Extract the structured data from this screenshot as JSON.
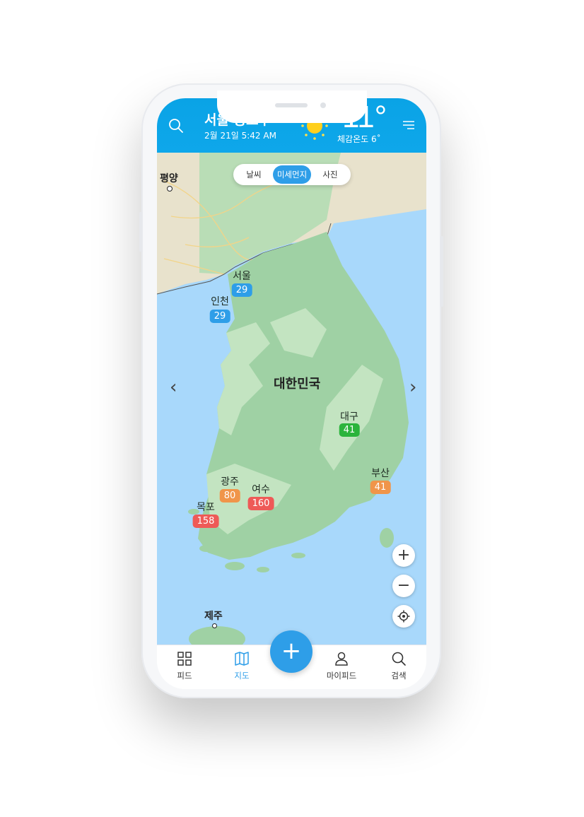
{
  "header": {
    "city": "서울 종로구",
    "datetime": "2월 21일 5:42 AM",
    "temperature": "11°",
    "feels_like": "체감온도 6˚",
    "weather_icon": "sun-icon"
  },
  "tabs": [
    {
      "label": "날씨",
      "active": false
    },
    {
      "label": "미세먼지",
      "active": true
    },
    {
      "label": "사진",
      "active": false
    }
  ],
  "map": {
    "country_label": "대한민국",
    "north_labels": [
      "평양"
    ],
    "island_label": "제주",
    "stations": [
      {
        "name": "서울",
        "value": "29",
        "level": "good",
        "color": "#2e9ee8"
      },
      {
        "name": "인천",
        "value": "29",
        "level": "good",
        "color": "#2e9ee8"
      },
      {
        "name": "대구",
        "value": "41",
        "level": "normal",
        "color": "#2bb43c"
      },
      {
        "name": "부산",
        "value": "41",
        "level": "bad",
        "color": "#f0954a"
      },
      {
        "name": "광주",
        "value": "80",
        "level": "bad",
        "color": "#f0954a"
      },
      {
        "name": "여수",
        "value": "160",
        "level": "very-bad",
        "color": "#ee5a57"
      },
      {
        "name": "목포",
        "value": "158",
        "level": "very-bad",
        "color": "#ee5a57"
      }
    ],
    "prev_arrow": "‹",
    "next_arrow": "›",
    "zoom_in": "+",
    "zoom_out": "−"
  },
  "bottom_nav": [
    {
      "label": "피드",
      "icon": "grid-icon",
      "active": false
    },
    {
      "label": "지도",
      "icon": "map-icon",
      "active": true
    },
    {
      "label": "마이피드",
      "icon": "person-icon",
      "active": false
    },
    {
      "label": "검색",
      "icon": "search-icon",
      "active": false
    }
  ],
  "fab_label": "+",
  "colors": {
    "header": "#0ea7ea",
    "accent": "#2e9ee8",
    "sea": "#a8d8fb",
    "land": "#9fd1a4"
  }
}
